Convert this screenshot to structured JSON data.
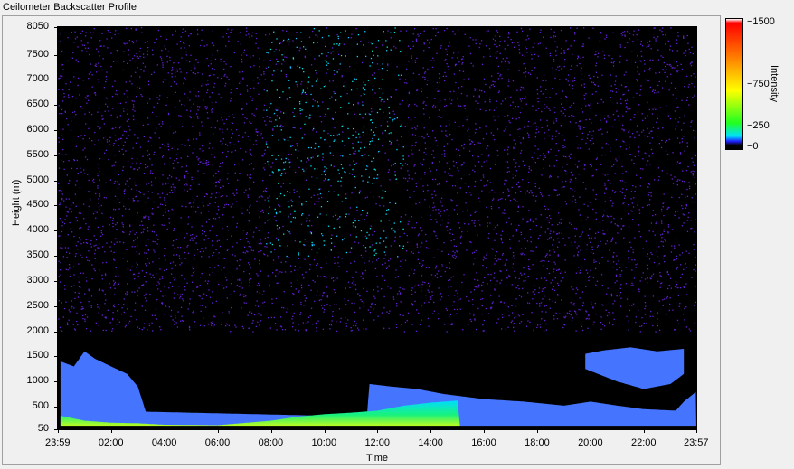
{
  "window": {
    "title": "Ceilometer Backscatter Profile"
  },
  "colorbar": {
    "title": "Intensity",
    "ticks": [
      "1500",
      "750",
      "250",
      "0"
    ],
    "tick_values": [
      1500,
      750,
      250,
      0
    ],
    "colors": [
      "#000000",
      "#2020ff",
      "#00e0ff",
      "#20ff20",
      "#ffff00",
      "#ff8000",
      "#ff0000",
      "#ffffff"
    ]
  },
  "chart_data": {
    "type": "heatmap",
    "title": "Ceilometer Backscatter Profile",
    "xlabel": "Time",
    "ylabel": "Height (m)",
    "x_ticks": [
      "23:59",
      "02:00",
      "04:00",
      "06:00",
      "08:00",
      "10:00",
      "12:00",
      "14:00",
      "16:00",
      "18:00",
      "20:00",
      "22:00",
      "23:57"
    ],
    "x_tick_hours": [
      0,
      2,
      4,
      6,
      8,
      10,
      12,
      14,
      16,
      18,
      20,
      22,
      23.97
    ],
    "y_ticks": [
      "8050",
      "7500",
      "7000",
      "6500",
      "6000",
      "5500",
      "5000",
      "4500",
      "4000",
      "3500",
      "3000",
      "2500",
      "2000",
      "1500",
      "1000",
      "500",
      "50"
    ],
    "y_tick_values": [
      8050,
      7500,
      7000,
      6500,
      6000,
      5500,
      5000,
      4500,
      4000,
      3500,
      3000,
      2500,
      2000,
      1500,
      1000,
      500,
      50
    ],
    "xlim": [
      0,
      23.97
    ],
    "ylim": [
      50,
      8050
    ],
    "zlim": [
      0,
      1500
    ],
    "colormap": "black-blue-cyan-green-yellow-orange-red-white",
    "layers": [
      {
        "name": "aerosol/boundary layer",
        "intensity": 120,
        "top_profile": [
          [
            0.1,
            1400
          ],
          [
            0.6,
            1300
          ],
          [
            1.0,
            1600
          ],
          [
            1.4,
            1450
          ],
          [
            2.0,
            1300
          ],
          [
            2.6,
            1150
          ],
          [
            3.0,
            900
          ],
          [
            3.3,
            400
          ],
          [
            11.6,
            300
          ],
          [
            11.7,
            950
          ],
          [
            12.5,
            900
          ],
          [
            13.5,
            850
          ],
          [
            14.5,
            750
          ],
          [
            16.0,
            650
          ],
          [
            17.5,
            600
          ],
          [
            19.0,
            520
          ],
          [
            20.0,
            600
          ],
          [
            21.0,
            520
          ],
          [
            22.0,
            450
          ],
          [
            23.2,
            420
          ],
          [
            23.5,
            600
          ],
          [
            23.97,
            800
          ]
        ]
      },
      {
        "name": "elevated layer",
        "intensity": 120,
        "base_profile": [
          [
            19.8,
            1250
          ],
          [
            21.0,
            1000
          ],
          [
            22.0,
            850
          ],
          [
            23.0,
            950
          ],
          [
            23.5,
            1150
          ]
        ],
        "top_profile": [
          [
            19.8,
            1550
          ],
          [
            20.5,
            1620
          ],
          [
            21.5,
            1680
          ],
          [
            22.5,
            1600
          ],
          [
            23.5,
            1650
          ]
        ]
      },
      {
        "name": "surface strong return",
        "intensity": 650,
        "top_profile": [
          [
            0.1,
            320
          ],
          [
            1.0,
            220
          ],
          [
            2.0,
            180
          ],
          [
            3.0,
            170
          ],
          [
            4.0,
            140
          ],
          [
            6.0,
            130
          ],
          [
            8.0,
            220
          ],
          [
            9.0,
            300
          ],
          [
            10.0,
            350
          ],
          [
            11.0,
            380
          ],
          [
            12.0,
            420
          ],
          [
            13.0,
            520
          ],
          [
            14.0,
            580
          ],
          [
            15.0,
            620
          ],
          [
            15.1,
            100
          ]
        ]
      },
      {
        "name": "upper scatter",
        "intensity": 260,
        "x_range": [
          7.8,
          13.0
        ],
        "y_range": [
          3500,
          8050
        ]
      }
    ]
  }
}
